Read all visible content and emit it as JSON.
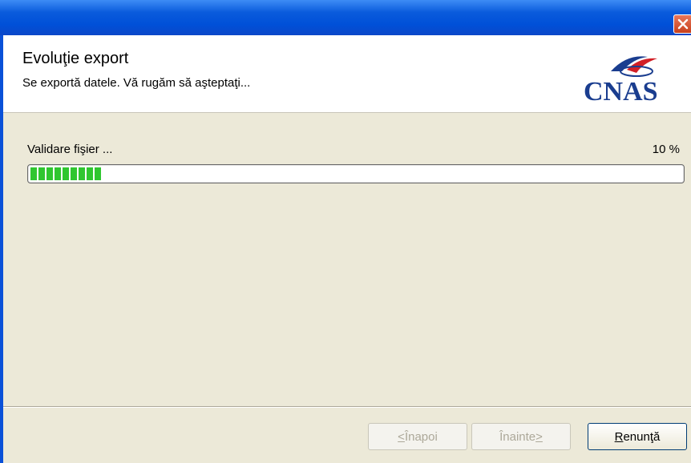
{
  "window": {
    "close_label": "×"
  },
  "header": {
    "title": "Evoluţie export",
    "subtitle": "Se exportă datele. Vă rugăm să aşteptaţi...",
    "logo_text": "CNAS"
  },
  "progress": {
    "status": "Validare fişier ...",
    "percent_label": "10 %",
    "value": 0.115
  },
  "buttons": {
    "back_key": "<",
    "back_text": " Înapoi",
    "next_text": "Înainte ",
    "next_key": ">",
    "cancel_key": "R",
    "cancel_text": "enunţă"
  },
  "colors": {
    "titlebar": "#0050d8",
    "progress_fill": "#30c630",
    "logo_blue": "#1a3d8f",
    "logo_red": "#d21f26"
  }
}
